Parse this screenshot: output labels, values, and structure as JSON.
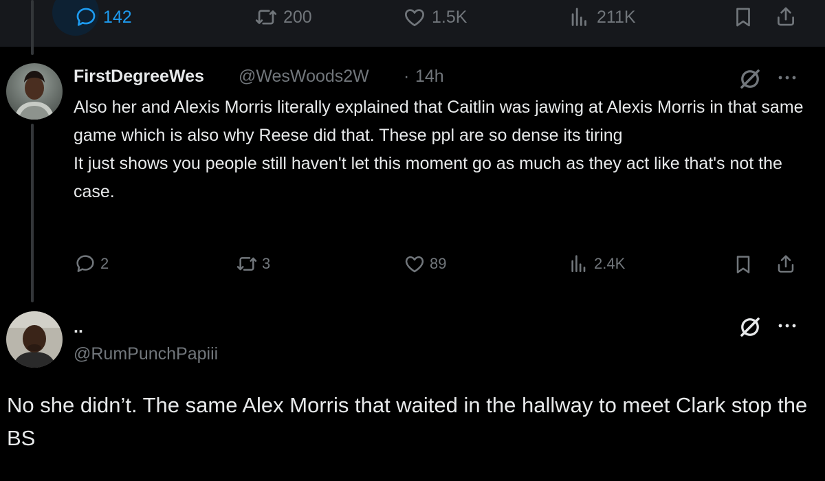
{
  "top_actions": {
    "replies": "142",
    "reposts": "200",
    "likes": "1.5K",
    "views": "211K"
  },
  "tweet1": {
    "display_name": "FirstDegreeWes",
    "handle": "@WesWoods2W",
    "separator": "·",
    "time": "14h",
    "text": "Also her and Alexis Morris literally explained that Caitlin was jawing at Alexis Morris in that same game which is also why Reese did that. These ppl are so dense its tiring\n It just shows you people still haven't let this moment go as much as they act like that's not the case.",
    "replies": "2",
    "reposts": "3",
    "likes": "89",
    "views": "2.4K"
  },
  "tweet2": {
    "display_name": "..",
    "handle": "@RumPunchPapiii",
    "text": "No she didn’t. The same Alex Morris that waited in the hallway to meet Clark stop the BS"
  },
  "icons": {
    "reply": "reply-icon",
    "repost": "repost-icon",
    "like": "heart-icon",
    "views": "views-icon",
    "bookmark": "bookmark-icon",
    "share": "share-icon",
    "grok": "grok-icon",
    "more": "more-icon"
  },
  "colors": {
    "background": "#000000",
    "panel": "#16181c",
    "text": "#e7e9ea",
    "muted": "#71767b",
    "accent": "#1d9bf0"
  }
}
